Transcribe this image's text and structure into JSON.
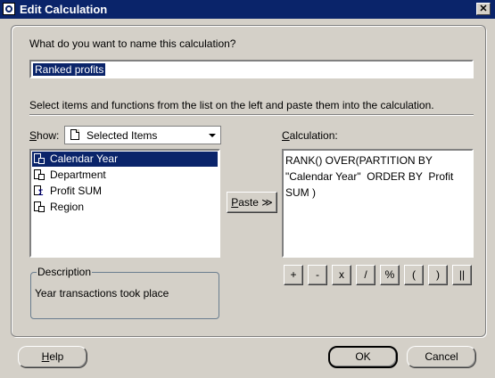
{
  "window": {
    "title": "Edit Calculation",
    "close_glyph": "✕"
  },
  "name_prompt": "What do you want to name this calculation?",
  "name_value": "Ranked profits",
  "instructions": "Select items and functions from the list on the left and paste them into the calculation.",
  "show": {
    "label_first": "S",
    "label_rest": "how:",
    "selected": "Selected Items"
  },
  "items": [
    {
      "label": "Calendar Year",
      "icon": "folder-item-icon",
      "selected": true
    },
    {
      "label": "Department",
      "icon": "folder-item-icon",
      "selected": false
    },
    {
      "label": "Profit SUM",
      "icon": "sum-item-icon",
      "selected": false
    },
    {
      "label": "Region",
      "icon": "folder-item-icon",
      "selected": false
    }
  ],
  "paste_button": {
    "first": "P",
    "rest": "aste",
    "glyph": "≫"
  },
  "calculation": {
    "label_first": "C",
    "label_rest": "alculation:",
    "text": "RANK() OVER(PARTITION BY\n\"Calendar Year\"  ORDER BY  Profit\nSUM )"
  },
  "description": {
    "legend": "Description",
    "text": "Year transactions took place"
  },
  "operators": [
    "+",
    "-",
    "x",
    "/",
    "%",
    "(",
    ")",
    "||"
  ],
  "buttons": {
    "help_first": "H",
    "help_rest": "elp",
    "ok": "OK",
    "cancel": "Cancel"
  }
}
